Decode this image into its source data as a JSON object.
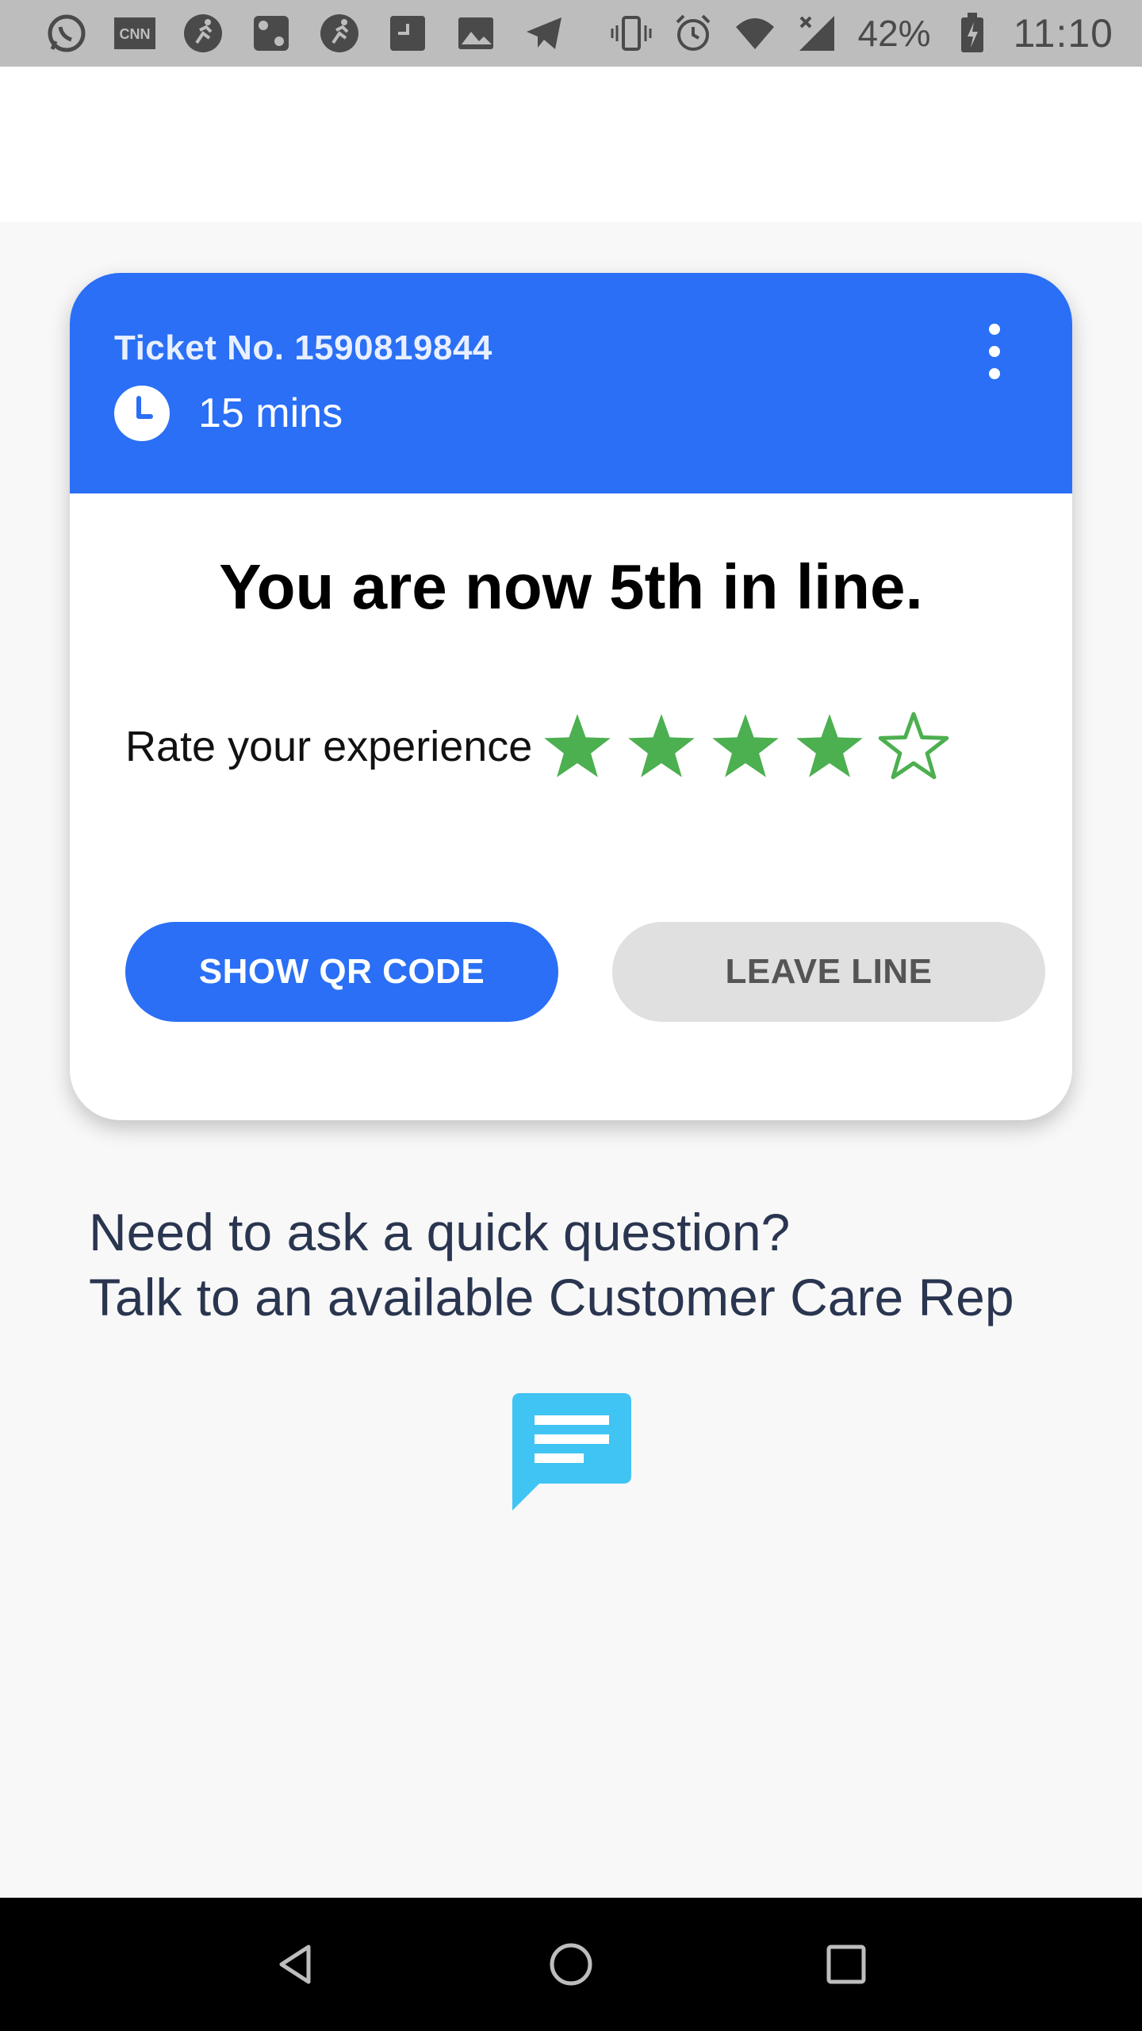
{
  "status_bar": {
    "battery": "42%",
    "time": "11:10",
    "left_icons": [
      "whatsapp-icon",
      "cnn-icon",
      "runner-icon",
      "dice-icon",
      "runner-icon",
      "screenshot-icon",
      "image-icon",
      "telegram-icon"
    ],
    "right_icons": [
      "vibrate-icon",
      "alarm-icon",
      "wifi-icon",
      "cellular-signal-icon",
      "battery-charging-icon"
    ]
  },
  "ticket": {
    "number_label": "Ticket No. 1590819844",
    "wait_time": "15 mins",
    "menu_icon": "more-vert-icon"
  },
  "queue": {
    "position_text": "You are now 5th in line."
  },
  "rating": {
    "label": "Rate your experience",
    "value": 4,
    "max": 5,
    "color": "#4caf50"
  },
  "actions": {
    "show_qr_label": "SHOW QR CODE",
    "leave_line_label": "LEAVE LINE"
  },
  "help": {
    "line1": "Need to ask a quick question?",
    "line2": "Talk to an available Customer Care Rep",
    "chat_icon": "chat-bubble-icon",
    "chat_icon_color": "#40c4f4"
  },
  "colors": {
    "accent": "#2a6ff5",
    "status_bar": "#bdbdbd",
    "nav_bar": "#000000"
  }
}
